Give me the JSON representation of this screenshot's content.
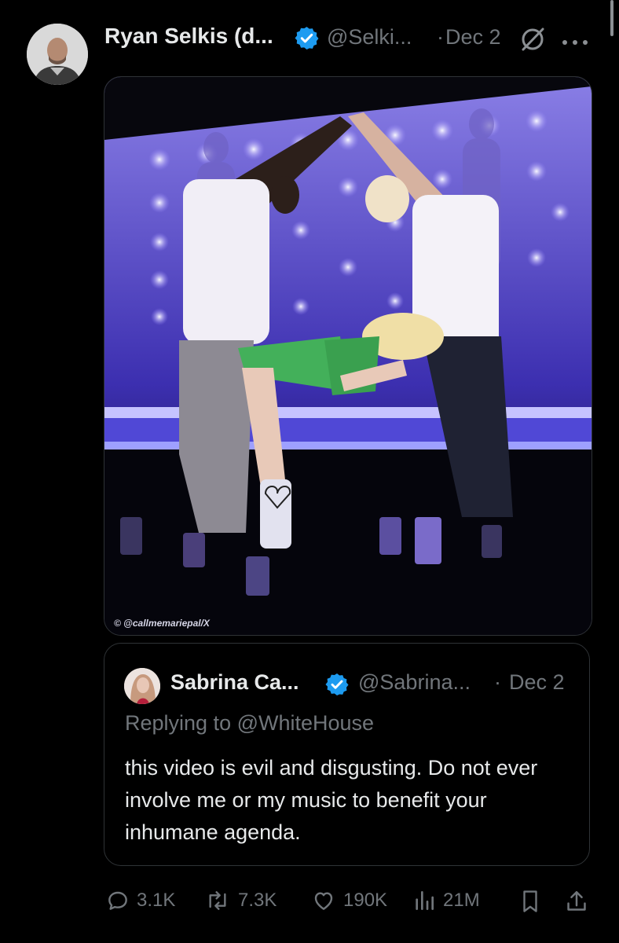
{
  "tweet": {
    "author_name": "Ryan Selkis (d...",
    "author_handle": "@Selki...",
    "date": "Dec 2",
    "media_credit": "© @callmemariepal/X"
  },
  "quoted_tweet": {
    "author_name": "Sabrina Ca...",
    "author_handle": "@Sabrina...",
    "date": "Dec 2",
    "replying_to": "Replying to @WhiteHouse",
    "text": "this video is evil and disgusting. Do not ever involve me or my music to benefit your inhumane agenda."
  },
  "actions": {
    "replies": "3.1K",
    "reposts": "7.3K",
    "likes": "190K",
    "views": "21M"
  },
  "separator_dot": "·",
  "colors": {
    "background": "#000000",
    "text_primary": "#e7e9ea",
    "text_secondary": "#71767b",
    "verified_blue": "#1d9bf0",
    "border": "#2f3336"
  },
  "icons": [
    "verified-badge-icon",
    "grok-icon",
    "more-icon",
    "reply-icon",
    "repost-icon",
    "like-icon",
    "views-icon",
    "bookmark-icon",
    "share-icon"
  ]
}
